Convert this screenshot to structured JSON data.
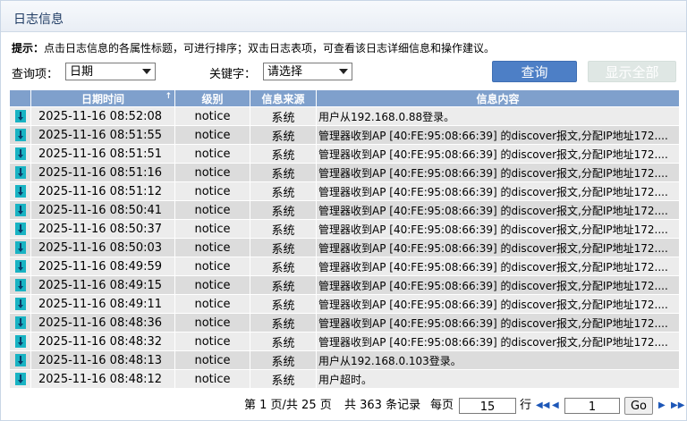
{
  "panel": {
    "title": "日志信息"
  },
  "tip": {
    "label": "提示：",
    "text": "点击日志信息的各属性标题，可进行排序；双击日志表项，可查看该日志详细信息和操作建议。"
  },
  "filter": {
    "query_label": "查询项：",
    "query_value": "日期",
    "keyword_label": "关键字：",
    "keyword_value": "请选择",
    "search_button": "查询",
    "show_all_button": "显示全部"
  },
  "table": {
    "headers": {
      "icon": "",
      "time": "日期时间",
      "level": "级别",
      "source": "信息来源",
      "message": "信息内容"
    },
    "rows": [
      {
        "time": "2025-11-16 08:52:08",
        "level": "notice",
        "source": "系统",
        "message": "用户从192.168.0.88登录。"
      },
      {
        "time": "2025-11-16 08:51:55",
        "level": "notice",
        "source": "系统",
        "message": "管理器收到AP [40:FE:95:08:66:39] 的discover报文,分配IP地址172...."
      },
      {
        "time": "2025-11-16 08:51:51",
        "level": "notice",
        "source": "系统",
        "message": "管理器收到AP [40:FE:95:08:66:39] 的discover报文,分配IP地址172...."
      },
      {
        "time": "2025-11-16 08:51:16",
        "level": "notice",
        "source": "系统",
        "message": "管理器收到AP [40:FE:95:08:66:39] 的discover报文,分配IP地址172...."
      },
      {
        "time": "2025-11-16 08:51:12",
        "level": "notice",
        "source": "系统",
        "message": "管理器收到AP [40:FE:95:08:66:39] 的discover报文,分配IP地址172...."
      },
      {
        "time": "2025-11-16 08:50:41",
        "level": "notice",
        "source": "系统",
        "message": "管理器收到AP [40:FE:95:08:66:39] 的discover报文,分配IP地址172...."
      },
      {
        "time": "2025-11-16 08:50:37",
        "level": "notice",
        "source": "系统",
        "message": "管理器收到AP [40:FE:95:08:66:39] 的discover报文,分配IP地址172...."
      },
      {
        "time": "2025-11-16 08:50:03",
        "level": "notice",
        "source": "系统",
        "message": "管理器收到AP [40:FE:95:08:66:39] 的discover报文,分配IP地址172...."
      },
      {
        "time": "2025-11-16 08:49:59",
        "level": "notice",
        "source": "系统",
        "message": "管理器收到AP [40:FE:95:08:66:39] 的discover报文,分配IP地址172...."
      },
      {
        "time": "2025-11-16 08:49:15",
        "level": "notice",
        "source": "系统",
        "message": "管理器收到AP [40:FE:95:08:66:39] 的discover报文,分配IP地址172...."
      },
      {
        "time": "2025-11-16 08:49:11",
        "level": "notice",
        "source": "系统",
        "message": "管理器收到AP [40:FE:95:08:66:39] 的discover报文,分配IP地址172...."
      },
      {
        "time": "2025-11-16 08:48:36",
        "level": "notice",
        "source": "系统",
        "message": "管理器收到AP [40:FE:95:08:66:39] 的discover报文,分配IP地址172...."
      },
      {
        "time": "2025-11-16 08:48:32",
        "level": "notice",
        "source": "系统",
        "message": "管理器收到AP [40:FE:95:08:66:39] 的discover报文,分配IP地址172...."
      },
      {
        "time": "2025-11-16 08:48:13",
        "level": "notice",
        "source": "系统",
        "message": "用户从192.168.0.103登录。"
      },
      {
        "time": "2025-11-16 08:48:12",
        "level": "notice",
        "source": "系统",
        "message": "用户超时。"
      }
    ]
  },
  "pager": {
    "summary": "第 1 页/共 25 页",
    "total": "共 363 条记录",
    "per_page_label": "每页",
    "per_page_value": "15",
    "row_unit": "行",
    "page_value": "1",
    "go_button": "Go"
  },
  "colors": {
    "header": "#7fa0cc",
    "primary": "#4d7fc6",
    "row_a": "#ececec",
    "row_b": "#dcdcdc",
    "icon": "#19b3c3"
  },
  "icons": {
    "row_icon": "info-down-arrow-icon",
    "first_page": "first-page-icon",
    "prev_page": "prev-page-icon",
    "next_page": "next-page-icon",
    "last_page": "last-page-icon"
  }
}
